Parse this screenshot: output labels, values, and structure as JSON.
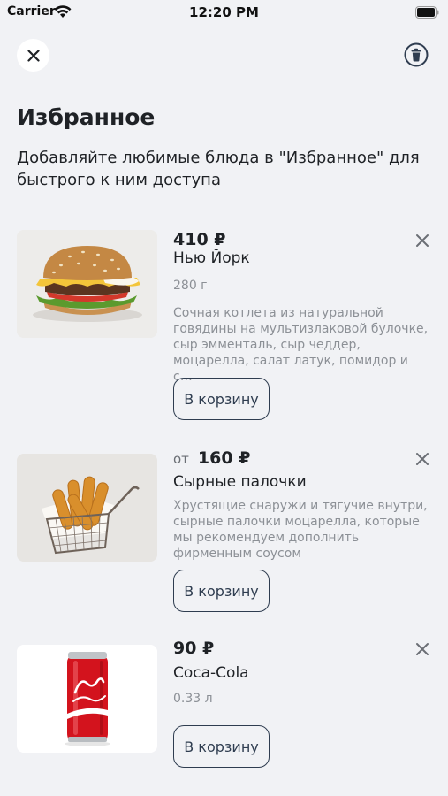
{
  "status_bar": {
    "carrier": "Carrier",
    "time": "12:20 PM"
  },
  "header": {
    "title": "Избранное",
    "subtitle": "Добавляйте любимые блюда в \"Избранное\" для быстрого к ним доступа"
  },
  "items": [
    {
      "price_prefix": "",
      "price": "410 ₽",
      "name": "Нью Йорк",
      "weight": "280 г",
      "description": "Сочная котлета из натуральной говядины на мультизлаковой булочке, сыр эмменталь, сыр чеддер, моцарелла, салат латук, помидор и с…",
      "cart_label": "В корзину"
    },
    {
      "price_prefix": "от",
      "price": "160 ₽",
      "name": "Сырные палочки",
      "weight": "",
      "description": "Хрустящие снаружи и тягучие внутри, сырные палочки моцарелла, которые мы рекомендуем дополнить фирменным соусом",
      "cart_label": "В корзину"
    },
    {
      "price_prefix": "",
      "price": "90 ₽",
      "name": "Coca-Cola",
      "weight": "0.33 л",
      "description": "",
      "cart_label": "В корзину"
    }
  ],
  "colors": {
    "background": "#F1F2F5",
    "text": "#1F2226",
    "muted": "#8C9096",
    "button_border": "#2F3D50"
  },
  "icons": [
    "wifi-icon",
    "battery-icon",
    "close-icon",
    "trash-icon",
    "remove-icon"
  ]
}
